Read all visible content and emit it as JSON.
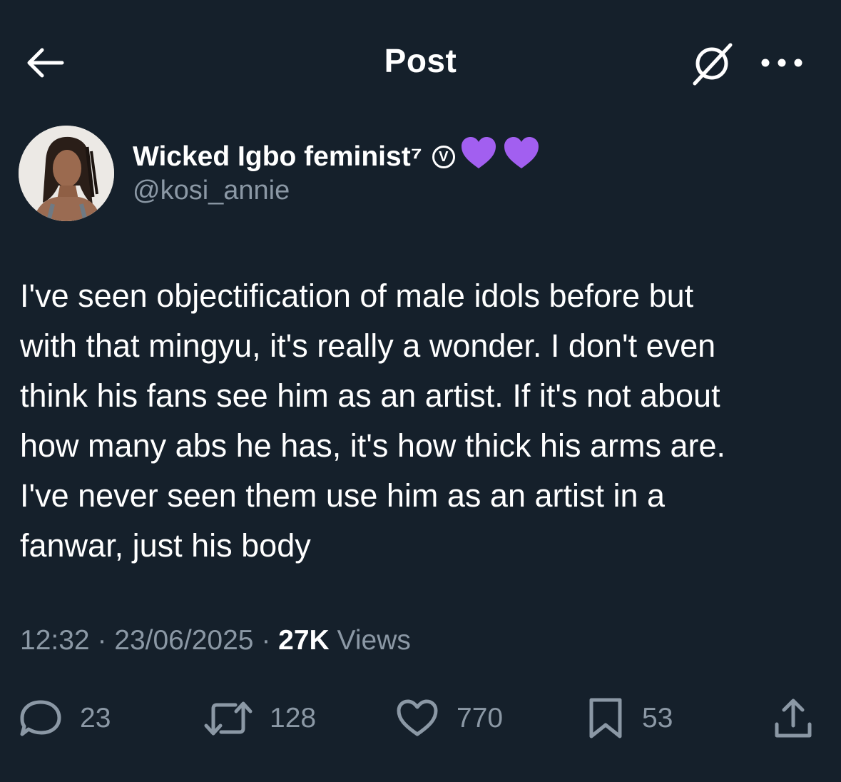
{
  "header": {
    "title": "Post",
    "back_icon": "back-arrow-icon",
    "grok_icon": "grok-icon",
    "more_icon": "more-icon"
  },
  "author": {
    "display_name": "Wicked Igbo feminist⁷",
    "badge": "V",
    "emoji": [
      "💜",
      "💜"
    ],
    "handle": "@kosi_annie"
  },
  "tweet": {
    "text": "I've seen objectification of male idols before but\nwith that mingyu, it's really a wonder. I don't even\nthink his fans see him as an artist. If it's not about\nhow many abs he has, it's how thick his arms are.\nI've never seen them use him as an artist in a\nfanwar, just his body"
  },
  "meta": {
    "time": "12:32",
    "separator": " · ",
    "date": "23/06/2025",
    "views_count": "27K",
    "views_label": " Views"
  },
  "actions": {
    "replies": "23",
    "reposts": "128",
    "likes": "770",
    "bookmarks": "53"
  },
  "colors": {
    "background": "#15202b",
    "text": "#ffffff",
    "secondary": "#8b98a5",
    "heart": "#a25ff0"
  }
}
